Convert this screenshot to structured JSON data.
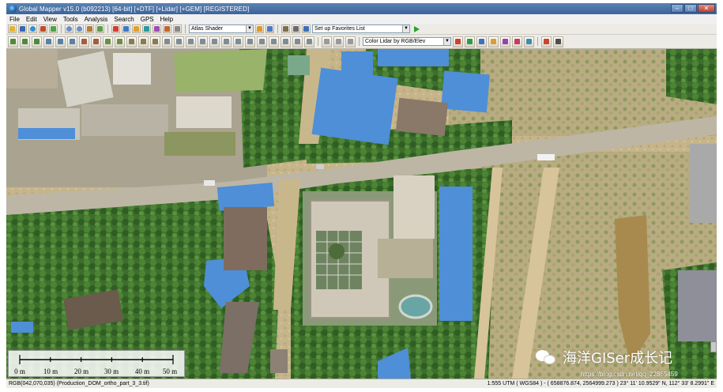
{
  "window": {
    "title": "Global Mapper v15.0 (b092213) [64-bit] [+DTF] [+Lidar] [+GEM]  [REGISTERED]",
    "controls": [
      "–",
      "□",
      "✕"
    ]
  },
  "menu": [
    "File",
    "Edit",
    "View",
    "Tools",
    "Analysis",
    "Search",
    "GPS",
    "Help"
  ],
  "toolbar": {
    "shader_combo": "Atlas Shader",
    "favorites_combo": "Set up Favorites List",
    "lidar_combo": "Color Lidar by RGB/Elev"
  },
  "colors": {
    "roof_blue": "#4e8fd8",
    "road": "#bdb6a5",
    "tree": "#3a6e2a",
    "bare": "#cbb98f",
    "pond": "#9ab36a"
  },
  "scalebar": {
    "labels": [
      "0 m",
      "10 m",
      "20 m",
      "30 m",
      "40 m",
      "50 m"
    ]
  },
  "watermark": {
    "text": "海洋GISer成长记",
    "url": "https://blog.csdn.net/qq_22865459"
  },
  "status": {
    "left": "RGB(042,070,035) (Production_DOM_ortho_part_3_3.tif)",
    "right": "1:555  UTM ( WGS84 ) - ( 658876.874, 2564999.273 ) 23° 11' 10.9529\" N, 112° 33' 8.2991\" E"
  }
}
